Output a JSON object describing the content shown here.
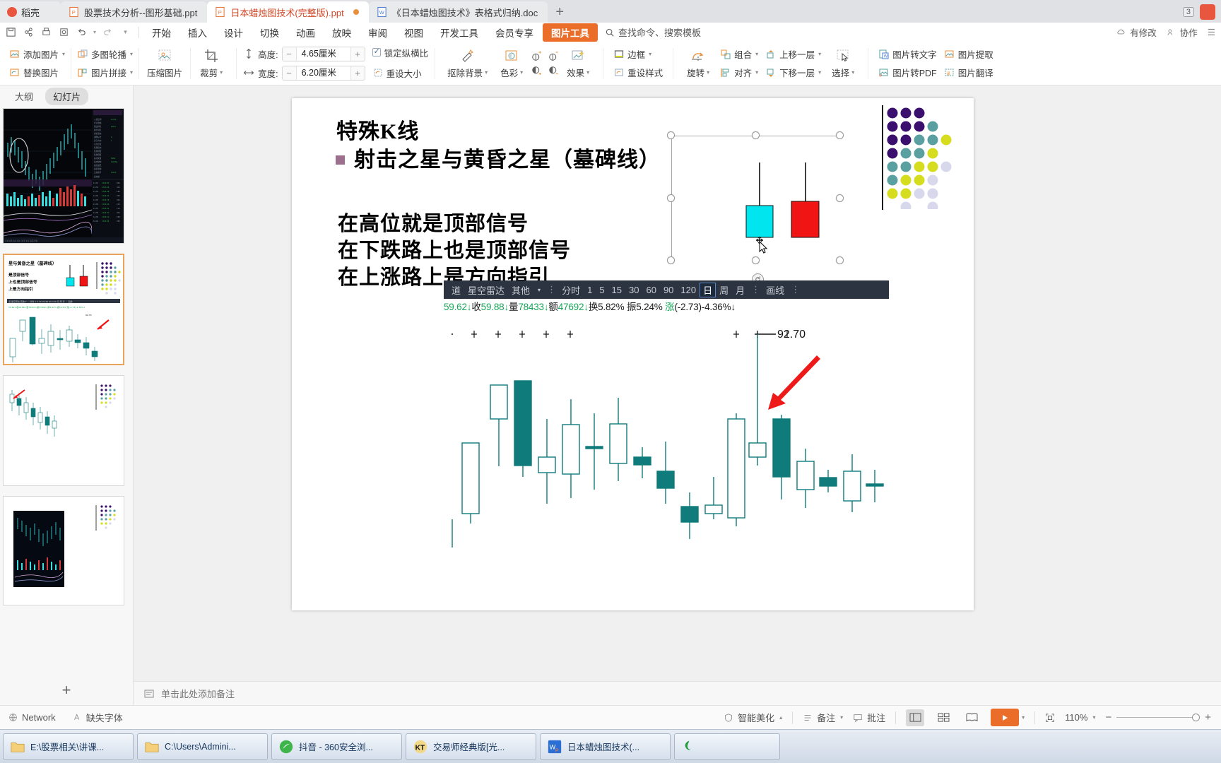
{
  "window": {
    "tabs": [
      {
        "label": "稻壳",
        "type": "home"
      },
      {
        "label": "股票技术分析--图形基础.ppt",
        "type": "ppt",
        "active": false
      },
      {
        "label": "日本蜡烛图技术(完整版).ppt",
        "type": "ppt",
        "active": true
      },
      {
        "label": "《日本蜡烛图技术》表格式归纳.doc",
        "type": "doc",
        "active": false
      }
    ],
    "new_tab": "+",
    "right_badge": "3",
    "account_icon": "user-avatar-icon"
  },
  "menu": {
    "quick_icons": [
      "save-icon",
      "share-icon",
      "print-icon",
      "print-preview-icon",
      "undo-icon",
      "redo-icon",
      "customize-caret-icon"
    ],
    "items": [
      "开始",
      "插入",
      "设计",
      "切换",
      "动画",
      "放映",
      "审阅",
      "视图",
      "开发工具",
      "会员专享"
    ],
    "tool_tab": "图片工具",
    "search_placeholder": "查找命令、搜索模板",
    "right_items": [
      "有修改",
      "协作"
    ]
  },
  "ribbon": {
    "groups": [
      {
        "items": [
          "添加图片",
          "替换图片",
          "多图轮播",
          "图片拼接",
          "压缩图片"
        ]
      }
    ],
    "add_picture": "添加图片",
    "replace_picture": "替换图片",
    "multi_carousel": "多图轮播",
    "picture_stitch": "图片拼接",
    "compress_picture": "压缩图片",
    "crop": "裁剪",
    "height_label": "高度:",
    "height_value": "4.65厘米",
    "width_label": "宽度:",
    "width_value": "6.20厘米",
    "lock_ratio": "锁定纵横比",
    "reset_size": "重设大小",
    "remove_bg": "抠除背景",
    "color": "色彩",
    "effects": "效果",
    "border": "边框",
    "reset_style": "重设样式",
    "rotate": "旋转",
    "group": "组合",
    "align": "对齐",
    "bring_forward": "上移一层",
    "send_backward": "下移一层",
    "select": "选择",
    "pic_to_text": "图片转文字",
    "pic_to_pdf": "图片转PDF",
    "pic_extract": "图片提取",
    "pic_translate": "图片翻译",
    "minus": "−",
    "plus": "+"
  },
  "left_panel": {
    "tabs": [
      {
        "label": "大纲",
        "selected": false
      },
      {
        "label": "幻灯片",
        "selected": true
      }
    ],
    "add_slide": "+"
  },
  "slide": {
    "title": "特殊K线",
    "bullet": "射击之星与黄昏之星（墓碑线）",
    "lines": [
      "在高位就是顶部信号",
      "在下跌路上也是顶部信号",
      "在上涨路上是方向指引"
    ],
    "selected_image": {
      "name": "candle-pair-image",
      "cyan_color": "#00e5ee",
      "red_color": "#f01414"
    },
    "deco_colors": [
      "#3b0f6e",
      "#5aa0a0",
      "#d6dc1e",
      "#d8d8ec"
    ]
  },
  "stock_chart": {
    "toolbar": {
      "left_items": [
        "道",
        "星空雷达",
        "其他"
      ],
      "periods": [
        "分时",
        "1",
        "5",
        "15",
        "30",
        "60",
        "90",
        "120",
        "日",
        "周",
        "月"
      ],
      "selected_period": "日",
      "draw": "画线"
    },
    "quote_line": "59.62↓收59.88↓量78433↓额47692↓换5.82% 振5.24% 涨(-2.73)-4.36%↓",
    "quote_parts": {
      "price": "59.62↓",
      "close_label": "收",
      "close": "59.88↓",
      "vol_label": "量",
      "vol": "78433↓",
      "amount_label": "额",
      "amount": "47692↓",
      "turn_label": "换",
      "turn": "5.82%",
      "amp_label": "振",
      "amp": "5.24%",
      "chg_label": "涨",
      "chg": "(-2.73)-4.36%↓"
    },
    "price_label": "92.70",
    "annotation": "red-arrow-pointing-to-shooting-star"
  },
  "chart_data": {
    "type": "candlestick",
    "title": "",
    "price_marker": 92.7,
    "candles": [
      {
        "i": 1,
        "open": 33,
        "high": 33,
        "low": 14,
        "close": 19,
        "up": true
      },
      {
        "i": 2,
        "open": 60,
        "high": 60,
        "low": 37,
        "close": 70,
        "up": true
      },
      {
        "i": 3,
        "open": 72,
        "high": 72,
        "low": 40,
        "close": 40,
        "up": false
      },
      {
        "i": 4,
        "open": 40,
        "high": 50,
        "low": 26,
        "close": 37,
        "up": true
      },
      {
        "i": 5,
        "open": 52,
        "high": 62,
        "low": 31,
        "close": 38,
        "up": true
      },
      {
        "i": 6,
        "open": 43,
        "high": 52,
        "low": 29,
        "close": 43,
        "up": true
      },
      {
        "i": 7,
        "open": 53,
        "high": 58,
        "low": 36,
        "close": 43,
        "up": true
      },
      {
        "i": 8,
        "open": 40,
        "high": 45,
        "low": 27,
        "close": 38,
        "up": false
      },
      {
        "i": 9,
        "open": 36,
        "high": 43,
        "low": 22,
        "close": 31,
        "up": false
      },
      {
        "i": 10,
        "open": 24,
        "high": 31,
        "low": 13,
        "close": 20,
        "up": false
      },
      {
        "i": 11,
        "open": 24,
        "high": 30,
        "low": 17,
        "close": 22,
        "up": true
      },
      {
        "i": 12,
        "open": 57,
        "high": 57,
        "low": 17,
        "close": 22,
        "up": true
      },
      {
        "i": 13,
        "open": 52,
        "high": 88,
        "low": 47,
        "close": 49,
        "up": true
      },
      {
        "i": 14,
        "open": 62,
        "high": 68,
        "low": 35,
        "close": 38,
        "up": false
      },
      {
        "i": 15,
        "open": 38,
        "high": 44,
        "low": 28,
        "close": 33,
        "up": true
      },
      {
        "i": 16,
        "open": 31,
        "high": 34,
        "low": 28,
        "close": 30,
        "up": false
      },
      {
        "i": 17,
        "open": 32,
        "high": 38,
        "low": 22,
        "close": 27,
        "up": true
      },
      {
        "i": 18,
        "open": 28,
        "high": 32,
        "low": 25,
        "close": 28,
        "up": true
      }
    ],
    "ylabel": "",
    "xlabel": ""
  },
  "notes": {
    "placeholder": "单击此处添加备注",
    "icon": "notes-icon"
  },
  "status_bar": {
    "network": "Network",
    "missing_font": "缺失字体",
    "smart_beautify": "智能美化",
    "notes": "备注",
    "comments": "批注",
    "views": [
      "normal-view-icon",
      "slide-sorter-icon",
      "reading-view-icon"
    ],
    "play": "play-icon",
    "zoom": "110%",
    "fit_icon": "fit-to-window-icon"
  },
  "taskbar": {
    "items": [
      {
        "label": "E:\\股票相关\\讲课...",
        "icon": "folder-icon"
      },
      {
        "label": "C:\\Users\\Admini...",
        "icon": "folder-icon"
      },
      {
        "label": "抖音 - 360安全浏...",
        "icon": "browser-icon"
      },
      {
        "label": "交易师经典版[光...",
        "icon": "trader-icon"
      },
      {
        "label": "日本蜡烛图技术(...",
        "icon": "wps-icon"
      },
      {
        "label": "",
        "icon": "green-app-icon"
      }
    ]
  }
}
